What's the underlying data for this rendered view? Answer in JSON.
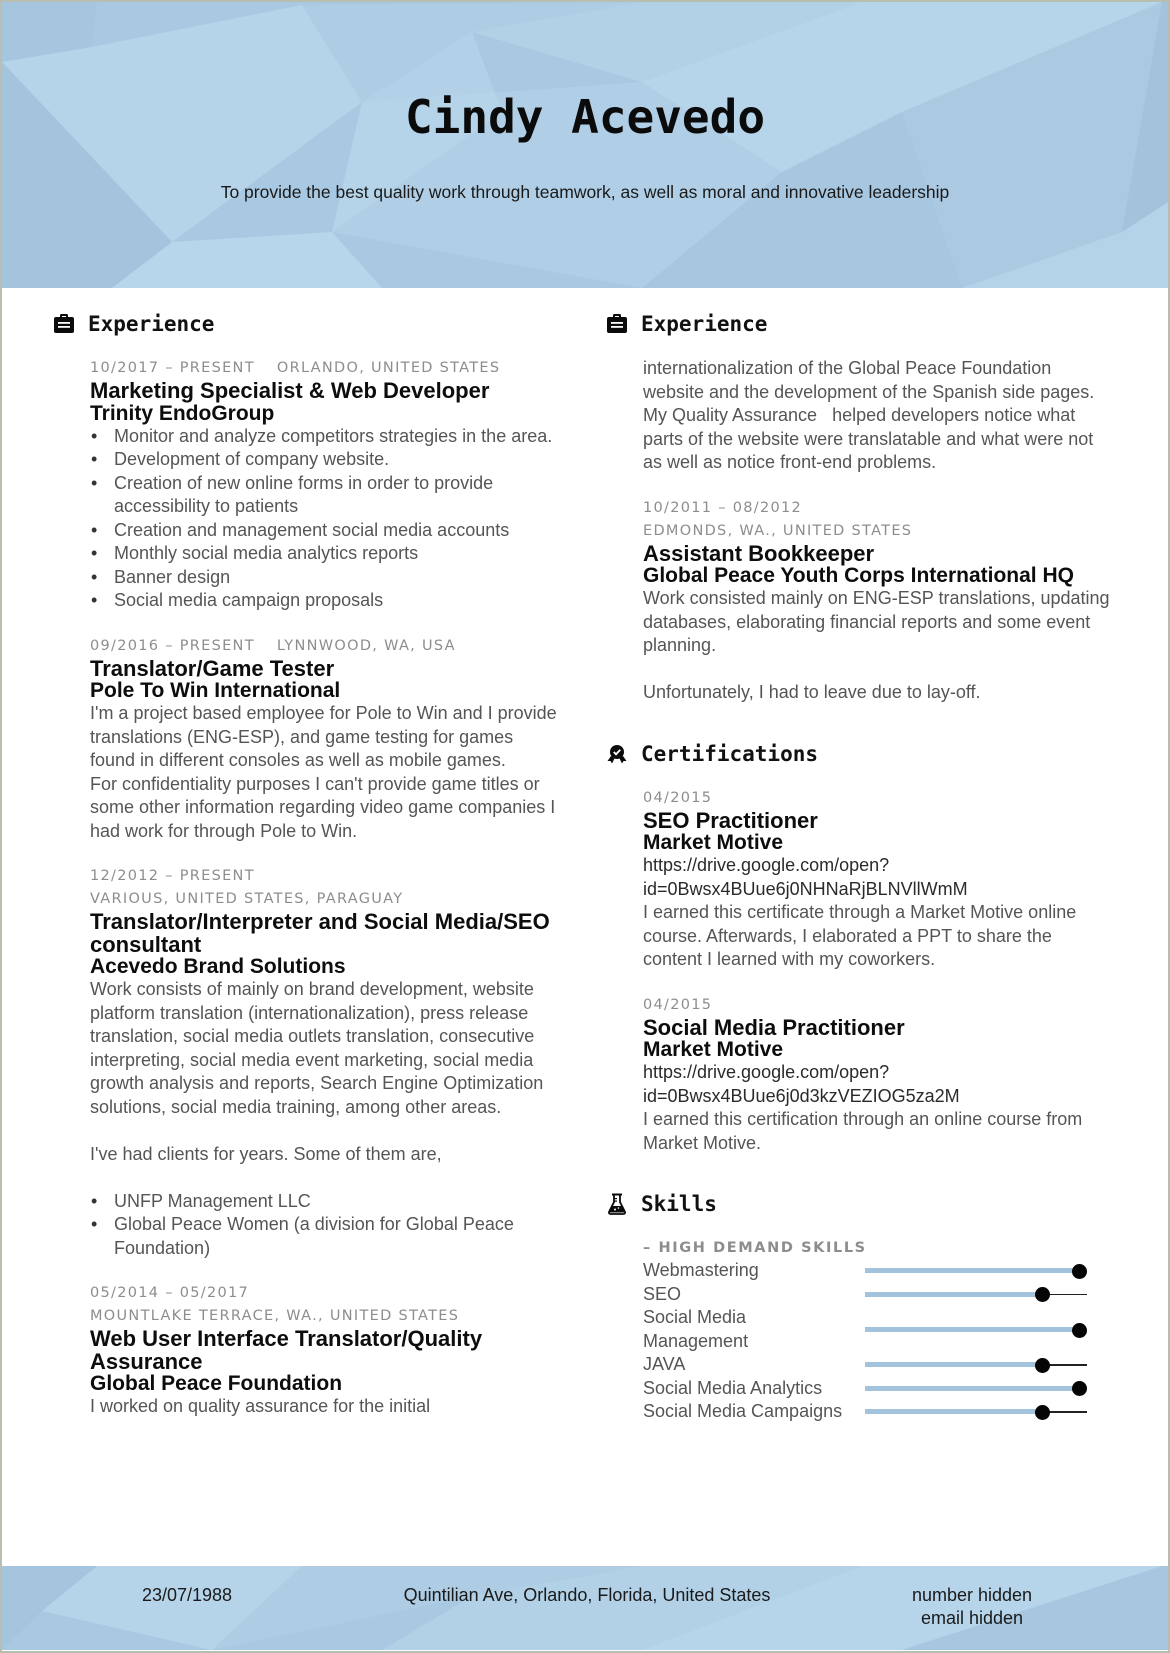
{
  "header": {
    "name": "Cindy Acevedo",
    "tagline": "To provide the best quality work through teamwork, as well as moral and innovative leadership"
  },
  "colors": {
    "band": "#adcbe3",
    "slider_fill": "#a3c2dc",
    "meta_gray": "#8d8d8d"
  },
  "left": {
    "experience": {
      "title": "Experience",
      "icon": "briefcase-icon",
      "entries": [
        {
          "dates": "10/2017 – PRESENT",
          "location": "ORLANDO, UNITED STATES",
          "role": "Marketing Specialist & Web Developer",
          "org": "Trinity EndoGroup",
          "bullets": [
            "Monitor and analyze competitors strategies in the area.",
            "Development of company website.",
            "Creation of new online forms in order to provide accessibility to patients",
            "Creation and management social media accounts",
            "Monthly social media analytics reports",
            "Banner design",
            "Social media campaign proposals"
          ]
        },
        {
          "dates": "09/2016 – PRESENT",
          "location": "LYNNWOOD, WA, USA",
          "role": "Translator/Game Tester",
          "org": "Pole To Win International",
          "paragraphs": [
            "I'm a project based employee for Pole to Win and I provide translations (ENG-ESP), and game testing for games found in different consoles as well as mobile games.",
            "For confidentiality purposes I can't provide game titles or some other information regarding video game companies I had work for through Pole to Win."
          ]
        },
        {
          "dates": "12/2012 – PRESENT",
          "location": "VARIOUS, UNITED STATES, PARAGUAY",
          "role": "Translator/Interpreter and Social Media/SEO consultant",
          "org": "Acevedo Brand Solutions",
          "paragraph1": "Work consists of mainly on brand development, website platform translation (internationalization), press release translation, social media outlets translation, consecutive interpreting, social media event marketing, social media growth analysis and reports, Search Engine Optimization solutions, social media training, among other areas.",
          "paragraph2": "I've had clients for years. Some of them are,",
          "bullets": [
            "UNFP Management LLC",
            "Global Peace Women (a division for Global Peace Foundation)"
          ]
        },
        {
          "dates": "05/2014 – 05/2017",
          "location": "MOUNTLAKE TERRACE, WA., UNITED STATES",
          "role": "Web User Interface Translator/Quality Assurance",
          "org": "Global Peace Foundation",
          "paragraph": "I worked on quality assurance for the initial"
        }
      ]
    }
  },
  "right": {
    "experience": {
      "title": "Experience",
      "icon": "briefcase-icon",
      "continuation": "internationalization of the Global Peace Foundation website and the development of the Spanish side pages. My Quality Assurance   helped developers notice what parts of the website were translatable and what were not as well as notice front-end problems.",
      "entries": [
        {
          "dates": "10/2011 – 08/2012",
          "location": "EDMONDS, WA., UNITED STATES",
          "role": "Assistant Bookkeeper",
          "org": "Global Peace Youth Corps International HQ",
          "paragraph1": "Work consisted mainly on ENG-ESP translations, updating databases, elaborating financial reports and some event planning.",
          "paragraph2": "Unfortunately, I had to leave due to lay-off."
        }
      ]
    },
    "certifications": {
      "title": "Certifications",
      "icon": "award-icon",
      "entries": [
        {
          "date": "04/2015",
          "title": "SEO Practitioner",
          "org": "Market Motive",
          "link_line1": "https://drive.google.com/open?",
          "link_line2": "id=0Bwsx4BUue6j0NHNaRjBLNVllWmM",
          "description": "I earned this certificate through a Market Motive online course. Afterwards, I elaborated a PPT to share the content I learned with my coworkers."
        },
        {
          "date": "04/2015",
          "title": "Social Media Practitioner",
          "org": "Market Motive",
          "link_line1": "https://drive.google.com/open?",
          "link_line2": "id=0Bwsx4BUue6j0d3kzVEZIOG5za2M",
          "description": "I earned this certification through an online course from Market Motive."
        }
      ]
    },
    "skills": {
      "title": "Skills",
      "icon": "flask-icon",
      "group_label": "– HIGH DEMAND SKILLS",
      "items": [
        {
          "name": "Webmastering",
          "level_percent": 100
        },
        {
          "name": "SEO",
          "level_percent": 80
        },
        {
          "name": "Social Media Management",
          "level_percent": 100
        },
        {
          "name": "JAVA",
          "level_percent": 80
        },
        {
          "name": "Social Media Analytics",
          "level_percent": 100
        },
        {
          "name": "Social Media Campaigns",
          "level_percent": 80
        }
      ]
    }
  },
  "footer": {
    "birthdate": "23/07/1988",
    "address": "Quintilian Ave, Orlando, Florida, United States",
    "phone": "number hidden",
    "email": "email hidden"
  }
}
